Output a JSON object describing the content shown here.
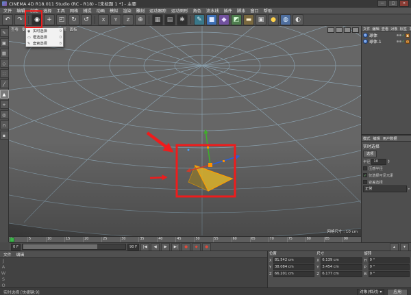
{
  "window": {
    "title": "CINEMA 4D R18.011 Studio (RC - R18) - [未标题 1 *] - 主要",
    "controls": {
      "min": "—",
      "max": "□",
      "close": "×"
    }
  },
  "menubar": {
    "items": [
      "文件",
      "编辑",
      "创建",
      "选择",
      "工具",
      "网格",
      "捕捉",
      "动画",
      "模拟",
      "渲染",
      "雕刻",
      "运动跟踪",
      "运动图形",
      "角色",
      "流水线",
      "插件",
      "脚本",
      "窗口",
      "帮助"
    ]
  },
  "toolbar": {
    "icons": [
      {
        "name": "undo",
        "glyph": "↶"
      },
      {
        "name": "redo",
        "glyph": "↷"
      },
      {
        "name": "live-selection",
        "glyph": "◉"
      },
      {
        "name": "move",
        "glyph": "+"
      },
      {
        "name": "scale",
        "glyph": "◰"
      },
      {
        "name": "rotate",
        "glyph": "↻"
      },
      {
        "name": "last-tool",
        "glyph": "↺"
      },
      {
        "name": "x-axis-lock",
        "glyph": "X"
      },
      {
        "name": "y-axis-lock",
        "glyph": "Y"
      },
      {
        "name": "z-axis-lock",
        "glyph": "Z"
      },
      {
        "name": "coordinate-system",
        "glyph": "⊕"
      },
      {
        "name": "render-view",
        "glyph": "▦"
      },
      {
        "name": "render-picture-viewer",
        "glyph": "▤"
      },
      {
        "name": "render-settings",
        "glyph": "✱"
      },
      {
        "name": "spline-pen",
        "glyph": "✎"
      },
      {
        "name": "add-cube",
        "glyph": "■"
      },
      {
        "name": "subdivision-surface",
        "glyph": "◆"
      },
      {
        "name": "symmetry",
        "glyph": "◩"
      },
      {
        "name": "floor",
        "glyph": "▬"
      },
      {
        "name": "camera",
        "glyph": "▣"
      },
      {
        "name": "light",
        "glyph": "●"
      },
      {
        "name": "sky",
        "glyph": "◍"
      },
      {
        "name": "material",
        "glyph": "◐"
      }
    ]
  },
  "selection_popup": {
    "items": [
      {
        "label": "实时选择",
        "shortcut": "9"
      },
      {
        "label": "框选选择",
        "shortcut": "0"
      },
      {
        "label": "套索选择",
        "shortcut": "8"
      }
    ]
  },
  "left_toolbar": {
    "icons": [
      {
        "name": "make-editable",
        "glyph": "✎"
      },
      {
        "name": "model-mode",
        "glyph": "▣"
      },
      {
        "name": "texture-mode",
        "glyph": "▦"
      },
      {
        "name": "workplane-mode",
        "glyph": "◇"
      },
      {
        "name": "points-mode",
        "glyph": "∷"
      },
      {
        "name": "edges-mode",
        "glyph": "╱"
      },
      {
        "name": "polygons-mode",
        "glyph": "▲"
      },
      {
        "name": "enable-axis",
        "glyph": "+"
      },
      {
        "name": "viewport-solo",
        "glyph": "◎"
      },
      {
        "name": "enable-snap",
        "glyph": "∩"
      },
      {
        "name": "locked-workplane",
        "glyph": "▪"
      }
    ]
  },
  "viewport": {
    "menu": [
      "查看",
      "摄像机",
      "显示",
      "选项",
      "过滤",
      "面板"
    ],
    "grid_label": "网格尺寸 : 10 cm"
  },
  "object_manager": {
    "menu": [
      "文件",
      "编辑",
      "查看",
      "对象",
      "标签",
      "书签"
    ],
    "objects": [
      {
        "name": "球体"
      },
      {
        "name": "球体.1"
      }
    ]
  },
  "attributes": {
    "tabs": [
      "模式",
      "编辑",
      "用户数据"
    ],
    "tool_label": "实时选择",
    "section": "选项",
    "rows": [
      {
        "label": "半径",
        "value": "10"
      },
      {
        "label": "压感半径",
        "mark": ""
      },
      {
        "label": "仅选择可见元素",
        "mark": "✓"
      },
      {
        "label": "容差选择",
        "mark": ""
      }
    ],
    "mode_value": "正常"
  },
  "timeline": {
    "ticks": [
      "0",
      "5",
      "10",
      "15",
      "20",
      "25",
      "30",
      "35",
      "40",
      "45",
      "50",
      "55",
      "60",
      "65",
      "70",
      "75",
      "80",
      "85",
      "90"
    ]
  },
  "transport": {
    "frame_start": "0 F",
    "frame_end": "90 F",
    "icons": [
      {
        "name": "goto-start",
        "glyph": "|◀"
      },
      {
        "name": "previous-frame",
        "glyph": "◀"
      },
      {
        "name": "play",
        "glyph": "▶"
      },
      {
        "name": "goto-end",
        "glyph": "▶|"
      }
    ],
    "record_icons": [
      {
        "name": "record-keyframe",
        "glyph": "●"
      },
      {
        "name": "record-position",
        "glyph": "◆"
      },
      {
        "name": "autokey",
        "glyph": "●"
      }
    ]
  },
  "materials": {
    "menu": [
      "文件",
      "编辑"
    ],
    "watermark": "JAWSOM"
  },
  "coordinates": {
    "groups": [
      {
        "title": "位置",
        "rows": [
          {
            "axis": "X",
            "value": "81.542 cm"
          },
          {
            "axis": "Y",
            "value": "38.084 cm"
          },
          {
            "axis": "Z",
            "value": "66.201 cm"
          }
        ]
      },
      {
        "title": "尺寸",
        "rows": [
          {
            "axis": "X",
            "value": "6.139 cm"
          },
          {
            "axis": "Y",
            "value": "3.454 cm"
          },
          {
            "axis": "Z",
            "value": "6.177 cm"
          }
        ]
      },
      {
        "title": "旋转",
        "rows": [
          {
            "axis": "H",
            "value": "0 °"
          },
          {
            "axis": "P",
            "value": "0 °"
          },
          {
            "axis": "B",
            "value": "0 °"
          }
        ]
      }
    ],
    "space": "对象(相对) ▾",
    "apply": "应用"
  },
  "statusbar": {
    "text": "实时选择 [快捷键:9]"
  }
}
